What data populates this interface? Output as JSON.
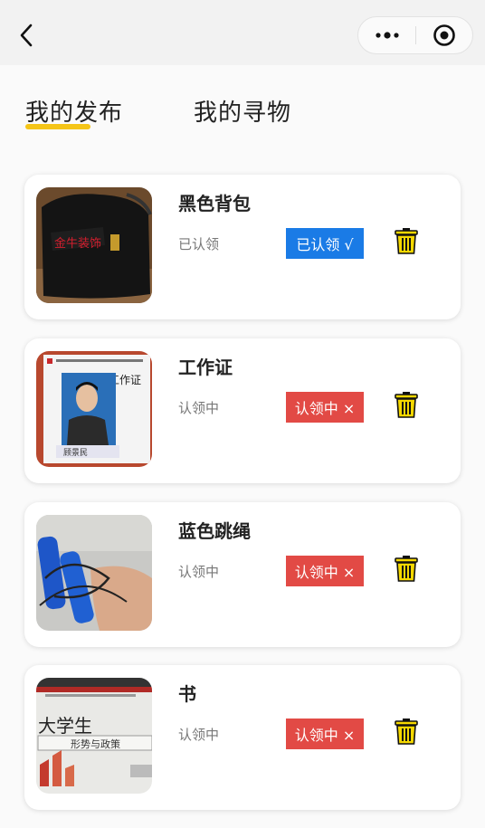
{
  "nav": {
    "back_icon": "chevron-left-icon",
    "more_icon": "more-dots-icon",
    "close_icon": "target-circle-icon"
  },
  "tabs": [
    {
      "label": "我的发布",
      "active": true
    },
    {
      "label": "我的寻物",
      "active": false
    }
  ],
  "items": [
    {
      "title": "黑色背包",
      "status": "已认领",
      "button": "已认领 √",
      "state": "claimed",
      "image": "black-backpack-photo"
    },
    {
      "title": "工作证",
      "status": "认领中",
      "button": "认领中 ×",
      "state": "pending",
      "image": "work-id-card-photo"
    },
    {
      "title": "蓝色跳绳",
      "status": "认领中",
      "button": "认领中 ×",
      "state": "pending",
      "image": "blue-jump-rope-photo"
    },
    {
      "title": "书",
      "status": "认领中",
      "button": "认领中 ×",
      "state": "pending",
      "image": "book-photo"
    }
  ],
  "colors": {
    "accent": "#f5c518",
    "claimed": "#1a7be6",
    "pending": "#e24a45",
    "trash": "#f5d800"
  }
}
